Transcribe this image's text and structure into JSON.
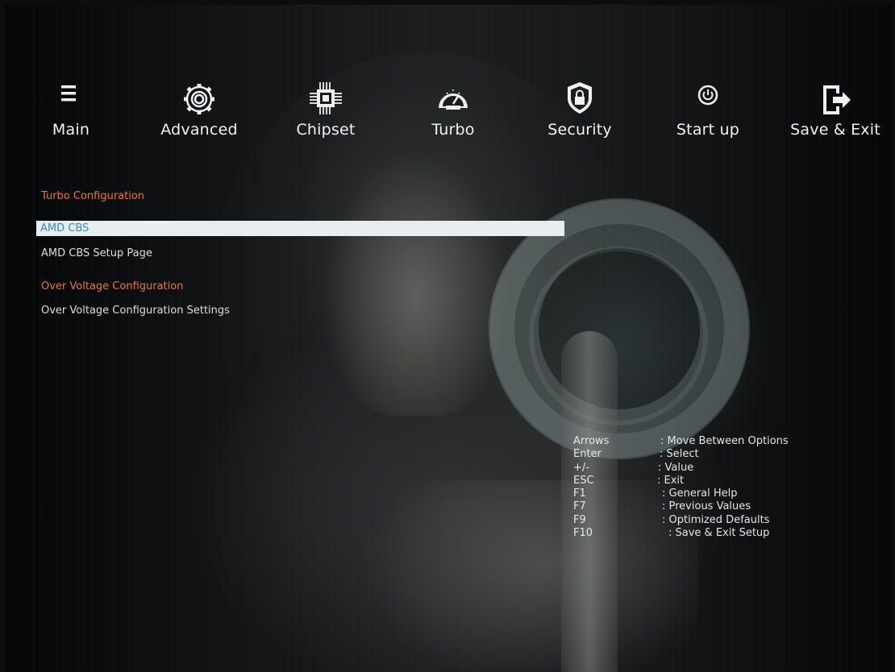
{
  "nav": {
    "tabs": [
      {
        "label": "Main",
        "icon": "menu-icon"
      },
      {
        "label": "Advanced",
        "icon": "gear-icon"
      },
      {
        "label": "Chipset",
        "icon": "chip-icon"
      },
      {
        "label": "Turbo",
        "icon": "speedometer-icon"
      },
      {
        "label": "Security",
        "icon": "shield-lock-icon"
      },
      {
        "label": "Start up",
        "icon": "power-icon"
      },
      {
        "label": "Save & Exit",
        "icon": "exit-icon"
      }
    ],
    "active_tab": "Turbo"
  },
  "content": {
    "section1_title": "Turbo Configuration",
    "selected_item": "AMD CBS",
    "item1": "AMD CBS Setup Page",
    "section2_title": "Over Voltage Configuration",
    "item2": "Over Voltage Configuration Settings"
  },
  "help": [
    {
      "key": "Arrows",
      "desc": ": Move Between Options"
    },
    {
      "key": "Enter",
      "desc": ": Select"
    },
    {
      "key": "+/-",
      "desc": ": Value"
    },
    {
      "key": "ESC",
      "desc": ": Exit"
    },
    {
      "key": "F1",
      "desc": ": General Help"
    },
    {
      "key": "F7",
      "desc": ": Previous Values"
    },
    {
      "key": "F9",
      "desc": ": Optimized Defaults"
    },
    {
      "key": "F10",
      "desc": ": Save & Exit Setup"
    }
  ],
  "colors": {
    "section_title": "#e07a3a",
    "selected_text": "#2a8fd0",
    "selected_bg": "#e9edef",
    "text": "#dedede"
  }
}
